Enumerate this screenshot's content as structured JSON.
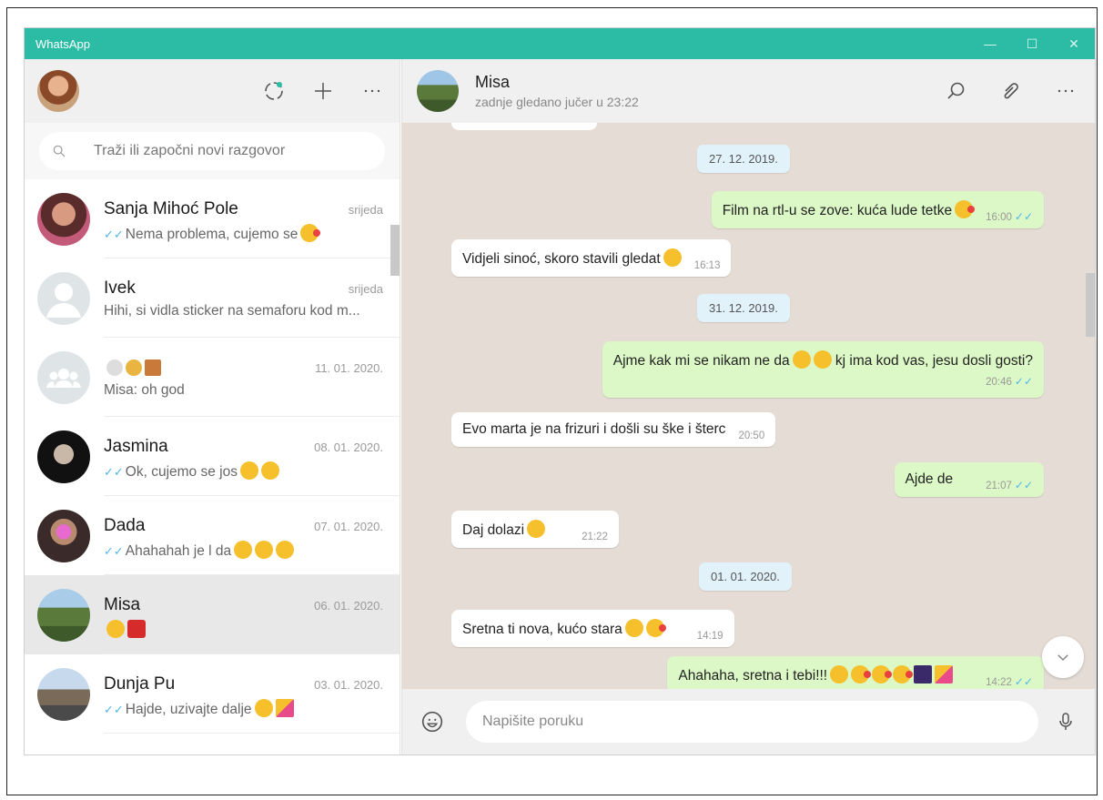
{
  "window": {
    "title": "WhatsApp",
    "controls": [
      "—",
      "☐",
      "✕"
    ]
  },
  "sidebar": {
    "icons": [
      "status-icon",
      "new-chat-icon",
      "menu-icon"
    ],
    "search": {
      "placeholder": "Traži ili započni novi razgovor"
    },
    "chats": [
      {
        "name": "Sanja Mihoć Pole",
        "date": "srijeda",
        "last": "Nema problema, cujemo se",
        "read": true
      },
      {
        "name": "Ivek",
        "date": "srijeda",
        "last": "Hihi, si vidla sticker na semaforu kod m...",
        "read": false
      },
      {
        "name": "",
        "date": "11. 01. 2020.",
        "last": "Misa: oh god",
        "read": false
      },
      {
        "name": "Jasmina",
        "date": "08. 01. 2020.",
        "last": "Ok, cujemo se jos",
        "read": true
      },
      {
        "name": "Dada",
        "date": "07. 01. 2020.",
        "last": "Ahahahah je l da",
        "read": true
      },
      {
        "name": "Misa",
        "date": "06. 01. 2020.",
        "last": "",
        "read": false,
        "active": true
      },
      {
        "name": "Dunja Pu",
        "date": "03. 01. 2020.",
        "last": "Hajde, uzivajte dalje",
        "read": true
      }
    ]
  },
  "conversation": {
    "contact_name": "Misa",
    "contact_status": "zadnje gledano jučer u 23:22",
    "dates": [
      "27. 12. 2019.",
      "31. 12. 2019.",
      "01. 01. 2020."
    ],
    "messages": [
      {
        "dir": "out",
        "text": "Film na rtl-u se zove: kuća lude tetke",
        "time": "16:00"
      },
      {
        "dir": "in",
        "text": "Vidjeli sinoć, skoro stavili gledat",
        "time": "16:13"
      },
      {
        "dir": "out",
        "text": "Ajme kak mi se nikam ne da",
        "text2": "kj ima kod vas, jesu dosli gosti?",
        "time": "20:46"
      },
      {
        "dir": "in",
        "text": "Evo marta je na frizuri i došli su ške i šterc",
        "time": "20:50"
      },
      {
        "dir": "out",
        "text": "Ajde de",
        "time": "21:07"
      },
      {
        "dir": "in",
        "text": "Daj dolazi",
        "time": "21:22"
      },
      {
        "dir": "in",
        "text": "Sretna ti nova, kućo stara",
        "time": "14:19"
      },
      {
        "dir": "out",
        "text": "Ahahaha, sretna i tebi!!!",
        "time": "14:22"
      }
    ],
    "composer": {
      "placeholder": "Napišite poruku"
    }
  },
  "colors": {
    "titlebar": "#2cbca6",
    "bubble_out": "#dcf8c6",
    "bubble_in": "#ffffff",
    "wallpaper": "#e5ddd5",
    "tick": "#4fb6ec"
  }
}
